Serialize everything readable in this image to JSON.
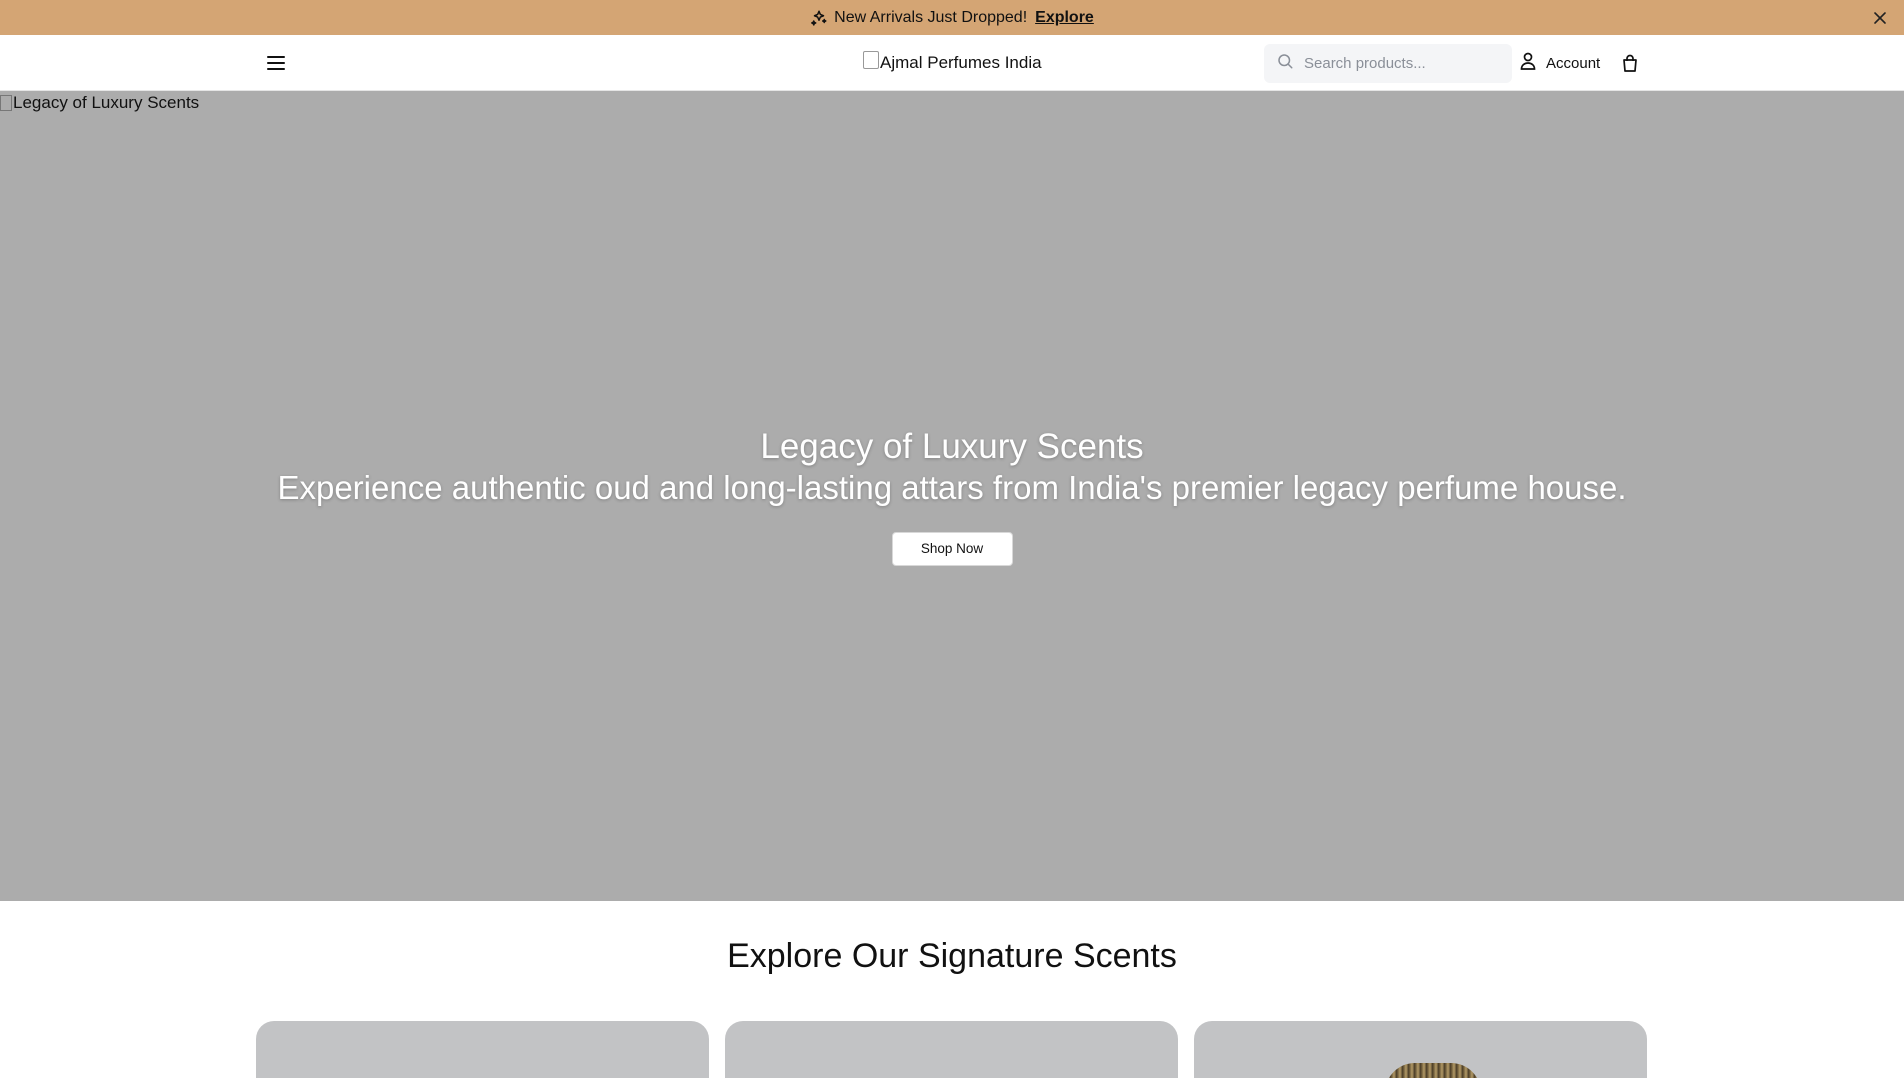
{
  "announcement": {
    "message": "New Arrivals Just Dropped!",
    "link_label": "Explore",
    "icon": "sparkle-icon"
  },
  "header": {
    "logo_alt": "Ajmal Perfumes India",
    "search_placeholder": "Search products...",
    "account_label": "Account",
    "icons": [
      "menu-icon",
      "search-icon",
      "user-icon",
      "shopping-bag-icon",
      "close-icon"
    ]
  },
  "hero": {
    "image_alt": "Legacy of Luxury Scents",
    "title": "Legacy of Luxury Scents",
    "subtitle": "Experience authentic oud and long-lasting attars from India's premier legacy perfume house.",
    "cta_label": "Shop Now"
  },
  "section": {
    "title": "Explore Our Signature Scents"
  },
  "colors": {
    "announcement_bg": "#d4a574",
    "hero_bg": "#acacac",
    "card_bg": "#c2c3c5"
  }
}
